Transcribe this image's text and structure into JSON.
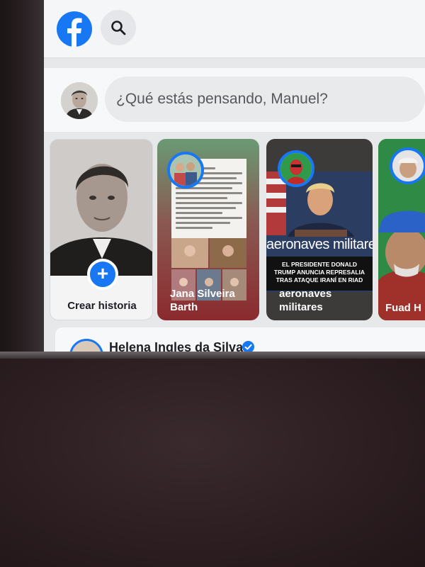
{
  "header": {
    "logo_icon": "facebook-f-icon",
    "search_icon": "search-icon"
  },
  "composer": {
    "placeholder": "¿Qué estás pensando, Manuel?"
  },
  "stories": {
    "create_label": "Crear historia",
    "add_icon": "plus-icon",
    "items": [
      {
        "name": "Jana Silveira Barth"
      },
      {
        "name": "aeronaves militares",
        "headline": "aeronaves militares",
        "subheadline": "EL PRESIDENTE DONALD TRUMP ANUNCIA REPRESALIA TRAS ATAQUE IRANÍ EN RIAD"
      },
      {
        "name": "Fuad H"
      }
    ]
  },
  "feed": {
    "post_author": "Helena Ingles da Silva",
    "verified_icon": "verified-badge-icon"
  },
  "colors": {
    "brand": "#1877f2",
    "background": "#e7e8ea"
  }
}
